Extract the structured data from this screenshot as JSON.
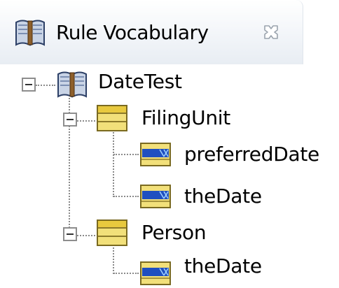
{
  "view": {
    "title": "Rule Vocabulary"
  },
  "tree": {
    "root": {
      "label": "DateTest"
    },
    "entities": [
      {
        "label": "FilingUnit",
        "attributes": [
          {
            "label": "preferredDate"
          },
          {
            "label": "theDate"
          }
        ]
      },
      {
        "label": "Person",
        "attributes": [
          {
            "label": "theDate"
          }
        ]
      }
    ]
  },
  "icons": {
    "view": "book-icon",
    "close": "close-icon",
    "root": "book-icon",
    "entity": "entity-icon",
    "attribute": "attribute-icon"
  },
  "colors": {
    "entity_fill": "#f2e07a",
    "attribute_fill": "#1f4fc0"
  }
}
